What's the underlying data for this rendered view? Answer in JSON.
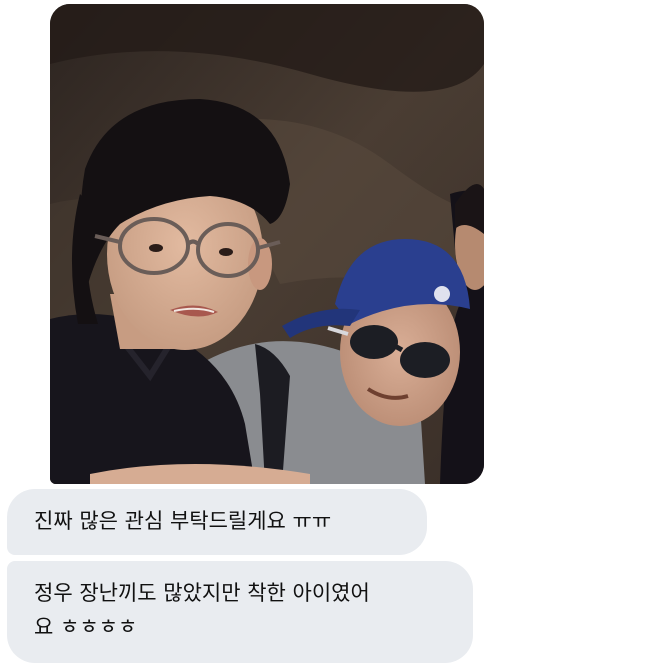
{
  "conversation": {
    "photo": {
      "icon": "photo-of-two-boys",
      "colors": {
        "background_rock": "#3a302a",
        "cap": "#2a3f8f",
        "shirt_left": "#17151c",
        "shirt_right": "#8a8c90",
        "skin": "#d6ac93",
        "hair": "#141012"
      }
    },
    "messages": [
      {
        "text": "진짜 많은 관심 부탁드릴게요 ㅠㅠ"
      },
      {
        "text": "정우 장난끼도 많았지만 착한 아이였어\n요 ㅎㅎㅎㅎ"
      }
    ],
    "bubble_color": "#e9ecf0"
  }
}
